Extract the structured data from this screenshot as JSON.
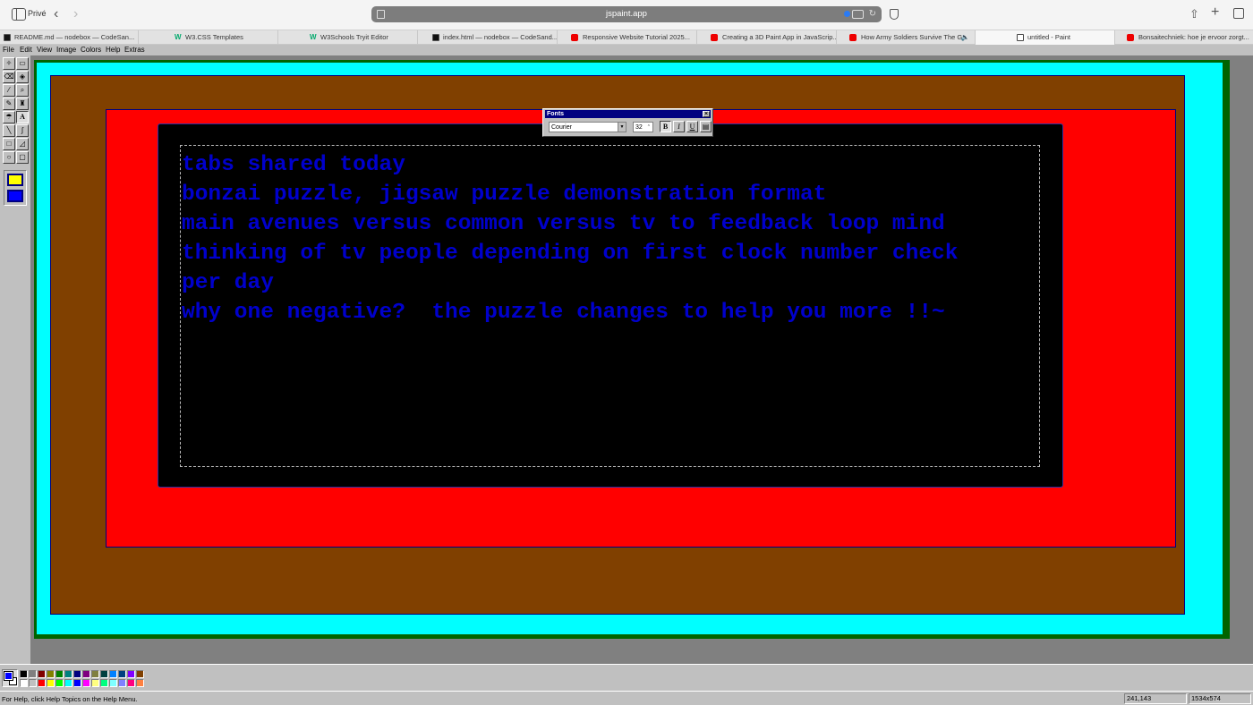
{
  "browser": {
    "profile": "Privé",
    "url": "jspaint.app",
    "tabs": [
      {
        "title": "README.md — nodebox — CodeSan...",
        "favicon": "codesandbox-icon"
      },
      {
        "title": "W3.CSS Templates",
        "favicon": "w3schools-icon"
      },
      {
        "title": "W3Schools Tryit Editor",
        "favicon": "w3schools-icon"
      },
      {
        "title": "index.html — nodebox — CodeSand...",
        "favicon": "codesandbox-icon"
      },
      {
        "title": "Responsive Website Tutorial 2025...",
        "favicon": "youtube-icon"
      },
      {
        "title": "Creating a 3D Paint App in JavaScrip...",
        "favicon": "youtube-icon"
      },
      {
        "title": "How Army Soldiers Survive The G...",
        "favicon": "youtube-icon"
      },
      {
        "title": "untitled - Paint",
        "favicon": "paint-icon"
      },
      {
        "title": "Bonsaitechniek: hoe je ervoor zorgt...",
        "favicon": "youtube-icon"
      }
    ]
  },
  "menubar": {
    "items": [
      "File",
      "Edit",
      "View",
      "Image",
      "Colors",
      "Help",
      "Extras"
    ]
  },
  "tools": {
    "text_tool_glyph": "A"
  },
  "canvas": {
    "colors": {
      "frame": "#006400",
      "outer": "#00ffff",
      "brown": "#804000",
      "red": "#ff0000",
      "inner": "#000000",
      "text": "#0000cc"
    },
    "text_lines": [
      "tabs shared today",
      "",
      "bonzai puzzle, jigsaw puzzle demonstration format",
      "",
      "main avenues versus common versus tv to feedback loop mind",
      "",
      "thinking of tv people depending on first clock number check",
      "per day",
      "",
      "why one negative?  the puzzle changes to help you more !!~"
    ]
  },
  "fonts_dialog": {
    "title": "Fonts",
    "font_name": "Courier",
    "font_size": "32",
    "bold": "B",
    "italic": "I",
    "underline": "U"
  },
  "palette": {
    "foreground": "#0000ff",
    "background": "#ffffff",
    "colors": [
      "#000000",
      "#808080",
      "#800000",
      "#808000",
      "#008000",
      "#008080",
      "#000080",
      "#800080",
      "#808040",
      "#004040",
      "#0080ff",
      "#004080",
      "#8000ff",
      "#804000",
      "#ffffff",
      "#c0c0c0",
      "#ff0000",
      "#ffff00",
      "#00ff00",
      "#00ffff",
      "#0000ff",
      "#ff00ff",
      "#ffff80",
      "#00ff80",
      "#80ffff",
      "#8080ff",
      "#ff0080",
      "#ff8040"
    ]
  },
  "status": {
    "help_text": "For Help, click Help Topics on the Help Menu.",
    "coordinates": "241,143",
    "canvas_size": "1534x574"
  }
}
